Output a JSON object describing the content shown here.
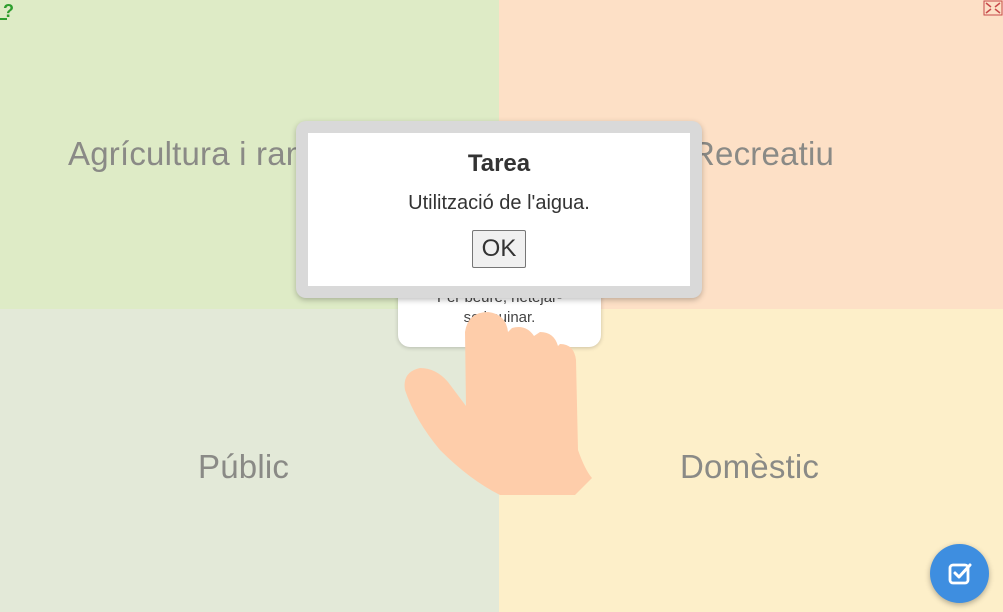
{
  "quadrants": {
    "top_left": "Agrícultura i ramaderia",
    "top_right": "Recreatiu",
    "bottom_left": "Públic",
    "bottom_right": "Domèstic"
  },
  "card": {
    "line1": "Per beure, netejar-",
    "line2": "se i cuinar."
  },
  "dialog": {
    "title": "Tarea",
    "message": "Utilització de l'aigua.",
    "ok_label": "OK"
  },
  "icons": {
    "help": "help-icon",
    "fullscreen": "fullscreen-icon",
    "check": "check-icon",
    "hand": "hand-pointer-icon"
  },
  "colors": {
    "top_left_bg": "#deebc6",
    "top_right_bg": "#fde0c6",
    "bottom_left_bg": "#e3e9d8",
    "bottom_right_bg": "#fdefc9",
    "check_button": "#3e8ee0"
  }
}
